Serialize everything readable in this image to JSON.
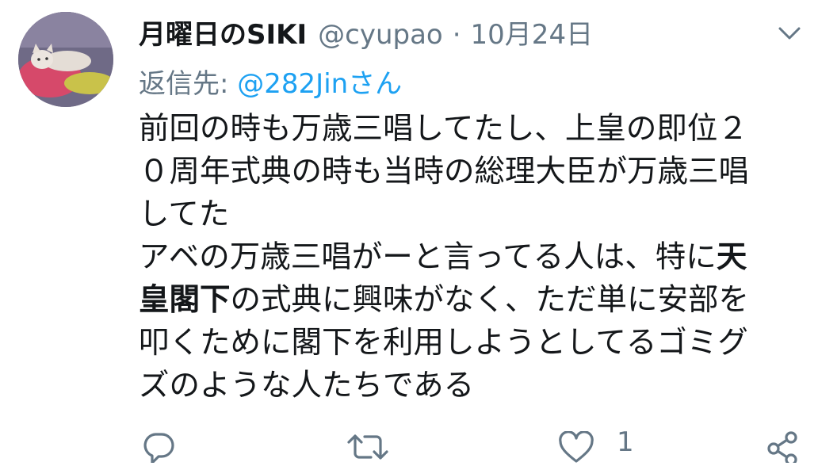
{
  "tweet": {
    "display_name": "月曜日のSIKI",
    "handle": "@cyupao",
    "separator": "·",
    "date": "10月24日",
    "reply_prefix": "返信先: ",
    "reply_to": "@282Jin",
    "reply_suffix": "さん",
    "body_lines": [
      {
        "parts": [
          "前回の時も万歳三唱してたし、上皇の即位２"
        ]
      },
      {
        "parts": [
          "０周年式典の時も当時の総理大臣が万歳三唱"
        ]
      },
      {
        "parts": [
          "してた"
        ]
      },
      {
        "parts": [
          "アベの万歳三唱がーと言ってる人は、特に",
          "天"
        ]
      },
      {
        "parts": [
          "皇閣下",
          "の式典に興味がなく、ただ単に安部を"
        ]
      },
      {
        "parts": [
          "叩くために閣下を利用しようとしてるゴミグ"
        ]
      },
      {
        "parts": [
          "ズのような人たちである"
        ]
      }
    ],
    "like_count": "1"
  },
  "icons": {
    "menu": "chevron-down-icon",
    "reply": "reply-icon",
    "retweet": "retweet-icon",
    "like": "heart-icon",
    "share": "share-icon"
  },
  "colors": {
    "text": "#14171a",
    "secondary": "#657786",
    "link": "#1da1f2"
  }
}
